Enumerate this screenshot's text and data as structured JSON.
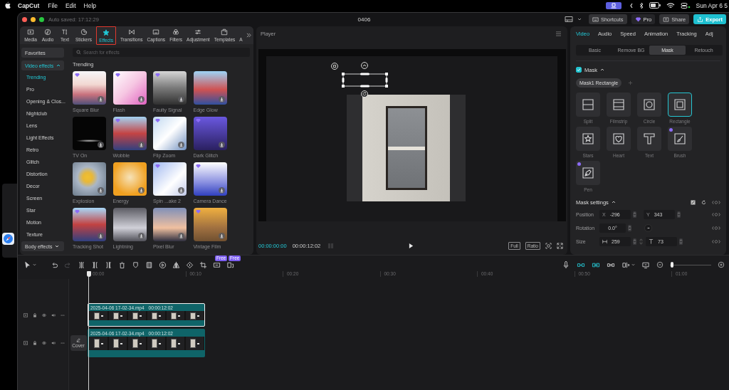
{
  "menu_bar": {
    "app_name": "CapCut",
    "menus": [
      "File",
      "Edit",
      "Help"
    ],
    "clock": "Sun Apr 6 5"
  },
  "window": {
    "autosave": "Auto saved: 17:12:29",
    "title": "0406",
    "actions": [
      {
        "kind": "shortcuts",
        "label": "Shortcuts"
      },
      {
        "kind": "pro",
        "label": "Pro"
      },
      {
        "kind": "share",
        "label": "Share"
      },
      {
        "kind": "export",
        "label": "Export"
      }
    ]
  },
  "media_tabs": [
    {
      "kind": "media",
      "label": "Media",
      "selected": false,
      "highlighted": false
    },
    {
      "kind": "audio",
      "label": "Audio",
      "selected": false,
      "highlighted": false
    },
    {
      "kind": "text",
      "label": "Text",
      "selected": false,
      "highlighted": false
    },
    {
      "kind": "stickers",
      "label": "Stickers",
      "selected": false,
      "highlighted": false
    },
    {
      "kind": "effects",
      "label": "Effects",
      "selected": true,
      "highlighted": true
    },
    {
      "kind": "transitions",
      "label": "Transitions",
      "selected": false,
      "highlighted": false
    },
    {
      "kind": "captions",
      "label": "Captions",
      "selected": false,
      "highlighted": false
    },
    {
      "kind": "filters",
      "label": "Filters",
      "selected": false,
      "highlighted": false
    },
    {
      "kind": "adjustment",
      "label": "Adjustment",
      "selected": false,
      "highlighted": false
    },
    {
      "kind": "templates",
      "label": "Templates",
      "selected": false,
      "highlighted": false
    },
    {
      "kind": "partial",
      "label": "A",
      "selected": false,
      "highlighted": false
    }
  ],
  "sidebar": {
    "items": [
      {
        "kind": "item",
        "label": "Favorites"
      },
      {
        "kind": "group",
        "label": "Video effects",
        "expanded": true,
        "children": [
          {
            "label": "Trending",
            "selected": true
          },
          {
            "label": "Pro",
            "selected": false
          },
          {
            "label": "Opening & Clos...",
            "selected": false
          },
          {
            "label": "Nightclub",
            "selected": false
          },
          {
            "label": "Lens",
            "selected": false
          },
          {
            "label": "Light Effects",
            "selected": false
          },
          {
            "label": "Retro",
            "selected": false
          },
          {
            "label": "Glitch",
            "selected": false
          },
          {
            "label": "Distortion",
            "selected": false
          },
          {
            "label": "Decor",
            "selected": false
          },
          {
            "label": "Screen",
            "selected": false
          },
          {
            "label": "Star",
            "selected": false
          },
          {
            "label": "Motion",
            "selected": false
          },
          {
            "label": "Texture",
            "selected": false
          }
        ]
      },
      {
        "kind": "group",
        "label": "Body effects",
        "expanded": false
      }
    ]
  },
  "effects": {
    "search": {
      "placeholder": "Search for effects"
    },
    "section": "Trending",
    "items": [
      {
        "name": "Square Blur",
        "premium": true
      },
      {
        "name": "Flash",
        "premium": true
      },
      {
        "name": "Faulty Signal",
        "premium": true
      },
      {
        "name": "Edge Glow",
        "premium": false
      },
      {
        "name": "TV On",
        "premium": false
      },
      {
        "name": "Wobble",
        "premium": true
      },
      {
        "name": "Flip Zoom",
        "premium": true
      },
      {
        "name": "Dark Glitch",
        "premium": true
      },
      {
        "name": "Explosion",
        "premium": false
      },
      {
        "name": "Energy",
        "premium": false
      },
      {
        "name": "Spin ...ake 2",
        "premium": true
      },
      {
        "name": "Camera Dance",
        "premium": true
      },
      {
        "name": "Tracking Shot",
        "premium": true
      },
      {
        "name": "Lightning",
        "premium": false
      },
      {
        "name": "Pixel Blur",
        "premium": false
      },
      {
        "name": "Vintage Film",
        "premium": true
      }
    ]
  },
  "player": {
    "title": "Player",
    "current_time": "00:00:00:00",
    "duration": "00:00:12:02",
    "view_buttons": [
      "Full",
      "Ratio"
    ]
  },
  "inspector": {
    "tabs": [
      {
        "label": "Video",
        "selected": true
      },
      {
        "label": "Audio",
        "selected": false
      },
      {
        "label": "Speed",
        "selected": false
      },
      {
        "label": "Animation",
        "selected": false
      },
      {
        "label": "Tracking",
        "selected": false
      },
      {
        "label": "Adj",
        "selected": false
      }
    ],
    "subtabs": [
      {
        "label": "Basic",
        "selected": false
      },
      {
        "label": "Remove BG",
        "selected": false
      },
      {
        "label": "Mask",
        "selected": true
      },
      {
        "label": "Retouch",
        "selected": false
      }
    ],
    "mask": {
      "label": "Mask",
      "checked": true,
      "expanded": true,
      "chip": "Mask1 Rectangle",
      "shapes": [
        {
          "kind": "split",
          "label": "Split",
          "selected": false,
          "premium": false
        },
        {
          "kind": "filmstrip",
          "label": "Filmstrip",
          "selected": false,
          "premium": false
        },
        {
          "kind": "circle",
          "label": "Circle",
          "selected": false,
          "premium": false
        },
        {
          "kind": "rectangle",
          "label": "Rectangle",
          "selected": true,
          "premium": false
        },
        {
          "kind": "stars",
          "label": "Stars",
          "selected": false,
          "premium": false
        },
        {
          "kind": "heart",
          "label": "Heart",
          "selected": false,
          "premium": false
        },
        {
          "kind": "text",
          "label": "Text",
          "selected": false,
          "premium": false
        },
        {
          "kind": "brush",
          "label": "Brush",
          "selected": false,
          "premium": true
        },
        {
          "kind": "pen",
          "label": "Pen",
          "selected": false,
          "premium": true
        }
      ]
    },
    "mask_settings": {
      "title": "Mask settings",
      "expanded": true,
      "rows": [
        {
          "kind": "position",
          "label": "Position",
          "fields": [
            {
              "prefix": "X",
              "value": "-296"
            },
            {
              "prefix": "Y",
              "value": "343"
            }
          ]
        },
        {
          "kind": "rotation",
          "label": "Rotation",
          "fields": [
            {
              "value": "0.0°"
            }
          ]
        },
        {
          "kind": "size",
          "label": "Size",
          "fields": [
            {
              "value": "259"
            },
            {
              "value": "73"
            }
          ]
        }
      ]
    }
  },
  "timeline": {
    "tools": [
      {
        "kind": "select",
        "disabled": false
      },
      {
        "kind": "undo",
        "disabled": false
      },
      {
        "kind": "redo",
        "disabled": true
      },
      {
        "kind": "split",
        "disabled": false
      },
      {
        "kind": "split-left",
        "disabled": false
      },
      {
        "kind": "split-right",
        "disabled": false
      },
      {
        "kind": "delete",
        "disabled": false
      },
      {
        "kind": "marker",
        "disabled": false
      },
      {
        "kind": "freeze",
        "disabled": false
      },
      {
        "kind": "reverse",
        "disabled": false
      },
      {
        "kind": "mirror",
        "disabled": false
      },
      {
        "kind": "rotate",
        "disabled": false
      },
      {
        "kind": "crop",
        "disabled": false
      },
      {
        "kind": "smart-crop",
        "disabled": false,
        "badge": "Free"
      },
      {
        "kind": "auto-reframe",
        "disabled": false,
        "badge": "Free"
      }
    ],
    "right_tools": [
      {
        "kind": "microphone",
        "on": false
      },
      {
        "kind": "magnet",
        "on": true
      },
      {
        "kind": "link",
        "on": true
      },
      {
        "kind": "preview-axis",
        "on": false
      },
      {
        "kind": "split-view",
        "on": false
      },
      {
        "kind": "fit",
        "on": false
      }
    ],
    "zoom": {
      "level": 0.06
    },
    "ruler": [
      "00:00",
      "00:10",
      "00:20",
      "00:30",
      "00:40",
      "00:50",
      "01:00"
    ],
    "tracks": [
      {
        "kind": "overlay",
        "clip": {
          "name": "2025-04-06 17-02-34.mp4",
          "duration": "00:00:12:02",
          "selected": true
        }
      },
      {
        "kind": "main",
        "cover": "Cover",
        "clip": {
          "name": "2025-04-06 17-02-34.mp4",
          "duration": "00:00:12:02",
          "selected": false
        }
      }
    ]
  }
}
